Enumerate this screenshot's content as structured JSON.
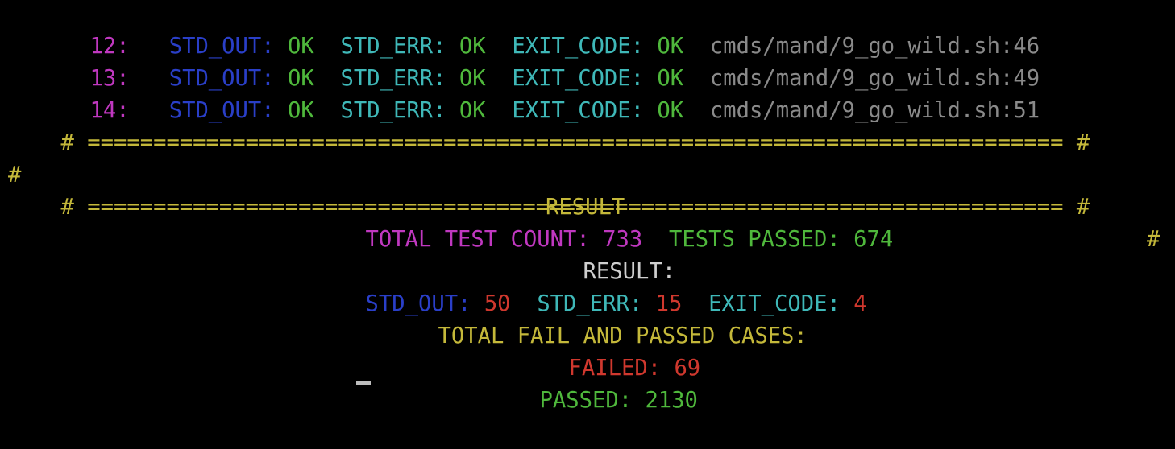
{
  "rows": [
    {
      "num": "12:",
      "std_out_label": "STD_OUT:",
      "std_out": "OK",
      "std_err_label": "STD_ERR:",
      "std_err": "OK",
      "exit_label": "EXIT_CODE:",
      "exit": "OK",
      "path": "cmds/mand/9_go_wild.sh:46"
    },
    {
      "num": "13:",
      "std_out_label": "STD_OUT:",
      "std_out": "OK",
      "std_err_label": "STD_ERR:",
      "std_err": "OK",
      "exit_label": "EXIT_CODE:",
      "exit": "OK",
      "path": "cmds/mand/9_go_wild.sh:49"
    },
    {
      "num": "14:",
      "std_out_label": "STD_OUT:",
      "std_out": "OK",
      "std_err_label": "STD_ERR:",
      "std_err": "OK",
      "exit_label": "EXIT_CODE:",
      "exit": "OK",
      "path": "cmds/mand/9_go_wild.sh:51"
    }
  ],
  "banner": {
    "hash": "#",
    "rule": "==========================================================================",
    "title": "RESULT"
  },
  "summary": {
    "total_label": "TOTAL TEST COUNT:",
    "total_value": "733",
    "passed_label": "TESTS PASSED:",
    "passed_value": "674",
    "result_label": "RESULT:",
    "std_out_label": "STD_OUT:",
    "std_out_value": "50",
    "std_err_label": "STD_ERR:",
    "std_err_value": "15",
    "exit_label": "EXIT_CODE:",
    "exit_value": "4",
    "cases_label": "TOTAL FAIL AND PASSED CASES:",
    "failed_label": "FAILED:",
    "failed_value": "69",
    "passed_cases_label": "PASSED:",
    "passed_cases_value": "2130"
  },
  "colors": {
    "background": "#000000",
    "line_number": "#c038c0",
    "std_out_label": "#2a3fc8",
    "cyan_label": "#3fb8b8",
    "ok": "#4fb83c",
    "path": "#8a8a8a",
    "banner": "#c4b83a",
    "fail_value": "#d0382e",
    "result_label": "#cfcfcf"
  }
}
